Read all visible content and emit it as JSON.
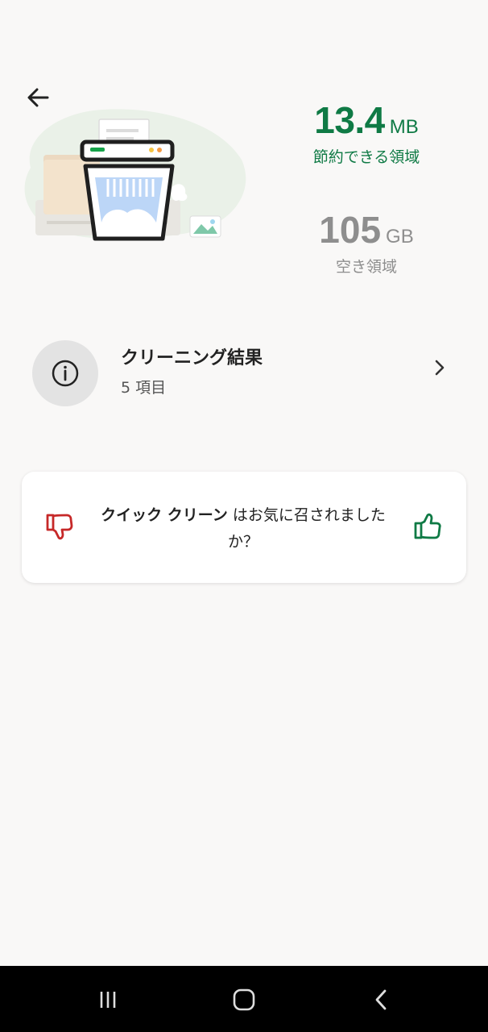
{
  "storage": {
    "saved_value": "13.4",
    "saved_unit": "MB",
    "saved_caption": "節約できる領域",
    "free_value": "105",
    "free_unit": "GB",
    "free_caption": "空き領域"
  },
  "results": {
    "title": "クリーニング結果",
    "subtitle": "5 項目"
  },
  "feedback": {
    "feature_name": "クイック クリーン",
    "question_rest": " はお気に召されましたか？"
  },
  "colors": {
    "accent_green": "#0f7a45",
    "dislike_red": "#c62828",
    "muted_gray": "#8e8e8e"
  },
  "icons": {
    "back": "arrow-left-icon",
    "info": "info-icon",
    "chevron": "chevron-right-icon",
    "dislike": "thumbs-down-icon",
    "like": "thumbs-up-icon",
    "nav_recents": "recent-apps-icon",
    "nav_home": "home-icon",
    "nav_back": "nav-back-icon"
  }
}
